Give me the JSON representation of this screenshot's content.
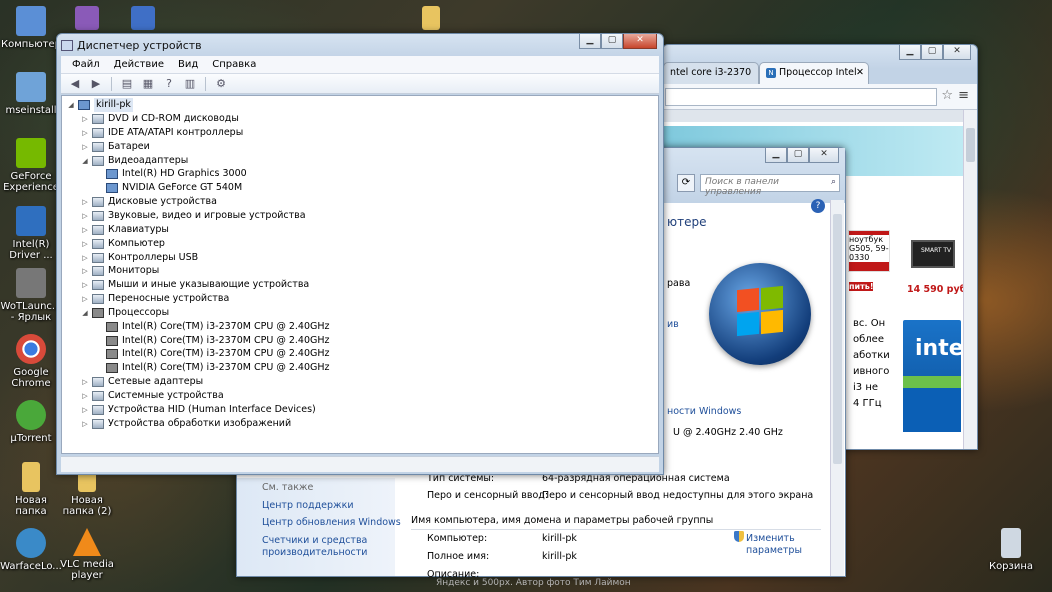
{
  "desktop_icons": [
    {
      "label": "Компьютер",
      "icon": "computer-icon",
      "color": "#5b8fd6"
    },
    {
      "label": "",
      "icon": "app-icon",
      "color": "#8a5ab8"
    },
    {
      "label": "",
      "icon": "word-doc-icon",
      "color": "#3f6fc6"
    },
    {
      "label": "",
      "icon": "folder-icon",
      "color": "#e8c460"
    },
    {
      "label": "mseinstall",
      "icon": "installer-icon",
      "color": "#6fa3d8"
    },
    {
      "label": "GeForce Experience",
      "icon": "geforce-icon",
      "color": "#76b900"
    },
    {
      "label": "Intel(R) Driver ...",
      "icon": "intel-driver-icon",
      "color": "#2f6fbf"
    },
    {
      "label": "WoTLaunc... - Ярлык",
      "icon": "wot-icon",
      "color": "#777777"
    },
    {
      "label": "Google Chrome",
      "icon": "chrome-icon",
      "color": "#d84a3a"
    },
    {
      "label": "µTorrent",
      "icon": "utorrent-icon",
      "color": "#4aa83a"
    },
    {
      "label": "Новая папка",
      "icon": "folder-icon",
      "color": "#e8c460"
    },
    {
      "label": "Новая папка (2)",
      "icon": "folder-icon",
      "color": "#e8c460"
    },
    {
      "label": "WarfaceLo...",
      "icon": "warface-icon",
      "color": "#3a8ac8"
    },
    {
      "label": "VLC media player",
      "icon": "vlc-icon",
      "color": "#f08a1a"
    },
    {
      "label": "Корзина",
      "icon": "recycle-bin-icon",
      "color": "#cfd8e2"
    }
  ],
  "device_manager": {
    "title": "Диспетчер устройств",
    "menu": [
      "Файл",
      "Действие",
      "Вид",
      "Справка"
    ],
    "root": "kirill-pk",
    "tree": [
      {
        "label": "DVD и CD-ROM дисководы",
        "level": 1,
        "expanded": false
      },
      {
        "label": "IDE ATA/ATAPI контроллеры",
        "level": 1,
        "expanded": false
      },
      {
        "label": "Батареи",
        "level": 1,
        "expanded": false
      },
      {
        "label": "Видеоадаптеры",
        "level": 1,
        "expanded": true
      },
      {
        "label": "Intel(R) HD Graphics 3000",
        "level": 2
      },
      {
        "label": "NVIDIA GeForce GT 540M",
        "level": 2
      },
      {
        "label": "Дисковые устройства",
        "level": 1,
        "expanded": false
      },
      {
        "label": "Звуковые, видео и игровые устройства",
        "level": 1,
        "expanded": false
      },
      {
        "label": "Клавиатуры",
        "level": 1,
        "expanded": false
      },
      {
        "label": "Компьютер",
        "level": 1,
        "expanded": false
      },
      {
        "label": "Контроллеры USB",
        "level": 1,
        "expanded": false
      },
      {
        "label": "Мониторы",
        "level": 1,
        "expanded": false
      },
      {
        "label": "Мыши и иные указывающие устройства",
        "level": 1,
        "expanded": false
      },
      {
        "label": "Переносные устройства",
        "level": 1,
        "expanded": false
      },
      {
        "label": "Процессоры",
        "level": 1,
        "expanded": true
      },
      {
        "label": "Intel(R) Core(TM) i3-2370M CPU @ 2.40GHz",
        "level": 2
      },
      {
        "label": "Intel(R) Core(TM) i3-2370M CPU @ 2.40GHz",
        "level": 2
      },
      {
        "label": "Intel(R) Core(TM) i3-2370M CPU @ 2.40GHz",
        "level": 2
      },
      {
        "label": "Intel(R) Core(TM) i3-2370M CPU @ 2.40GHz",
        "level": 2
      },
      {
        "label": "Сетевые адаптеры",
        "level": 1,
        "expanded": false
      },
      {
        "label": "Системные устройства",
        "level": 1,
        "expanded": false
      },
      {
        "label": "Устройства HID (Human Interface Devices)",
        "level": 1,
        "expanded": false
      },
      {
        "label": "Устройства обработки изображений",
        "level": 1,
        "expanded": false
      }
    ]
  },
  "browser": {
    "tabs": [
      {
        "label": "ntel core i3-2370",
        "active": false
      },
      {
        "label": "Процессор Intel",
        "active": true
      }
    ],
    "ad_laptop": "ноутбук G505, 59-0330",
    "ad_price_label": "пить!",
    "ad_tv_price": "14 590 руб.",
    "ad_tv_brand": "SMART TV",
    "text_fragments": [
      "вс. Он",
      "облее",
      "аботки",
      "ивного",
      "i3 не",
      "4 ГГц"
    ],
    "intel_logo": "intel"
  },
  "control_panel": {
    "search_placeholder": "Поиск в панели управления",
    "heading_fragment": "ютере",
    "fragment_rights": "рава",
    "fragment_link": "ив",
    "perf_link": "ности Windows",
    "cpu_fragment": "U @ 2.40GHz  2.40 GHz",
    "system_type_label": "Тип системы:",
    "system_type_value": "64-разрядная операционная система",
    "pen_label": "Перо и сенсорный ввод:",
    "pen_value": "Перо и сенсорный ввод недоступны для этого экрана",
    "section_title": "Имя компьютера, имя домена и параметры рабочей группы",
    "computer_label": "Компьютер:",
    "computer_value": "kirill-pk",
    "fullname_label": "Полное имя:",
    "fullname_value": "kirill-pk",
    "description_label": "Описание:",
    "change_link": "Изменить параметры",
    "see_also": "См. также",
    "left_links": [
      "Центр поддержки",
      "Центр обновления Windows",
      "Счетчики и средства производительности"
    ]
  },
  "footer_text": "Яндекс и 500px. Автор фото Тим Лаймон"
}
